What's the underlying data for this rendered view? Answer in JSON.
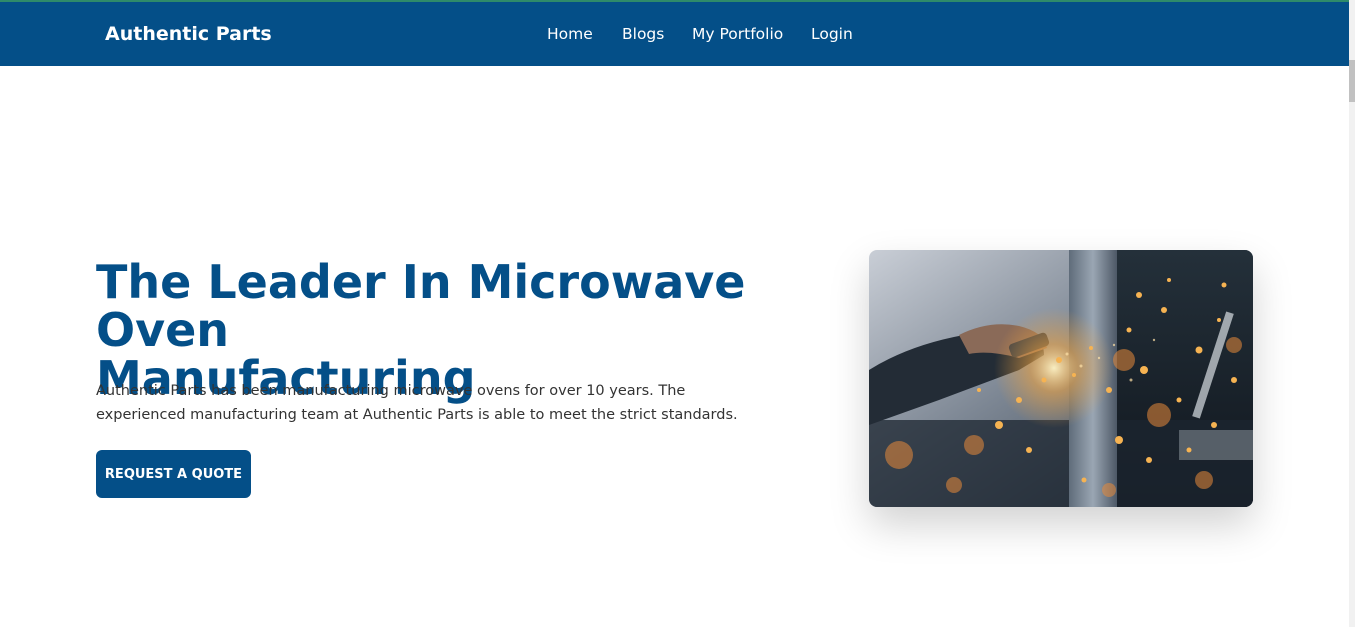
{
  "navbar": {
    "brand": "Authentic Parts",
    "links": [
      "Home",
      "Blogs",
      "My Portfolio",
      "Login"
    ],
    "background": "#044f88"
  },
  "hero": {
    "title_line1": "The Leader In Microwave Oven",
    "title_line2": "Manufacturing",
    "description": "Authentic Parts has been manufacturing microwave ovens for over 10 years. The experienced manufacturing team at Authentic Parts is able to meet the strict standards.",
    "cta_label": "REQUEST A QUOTE",
    "accent_color": "#044f88",
    "image_subject": "worker grinding metal with flying sparks"
  }
}
